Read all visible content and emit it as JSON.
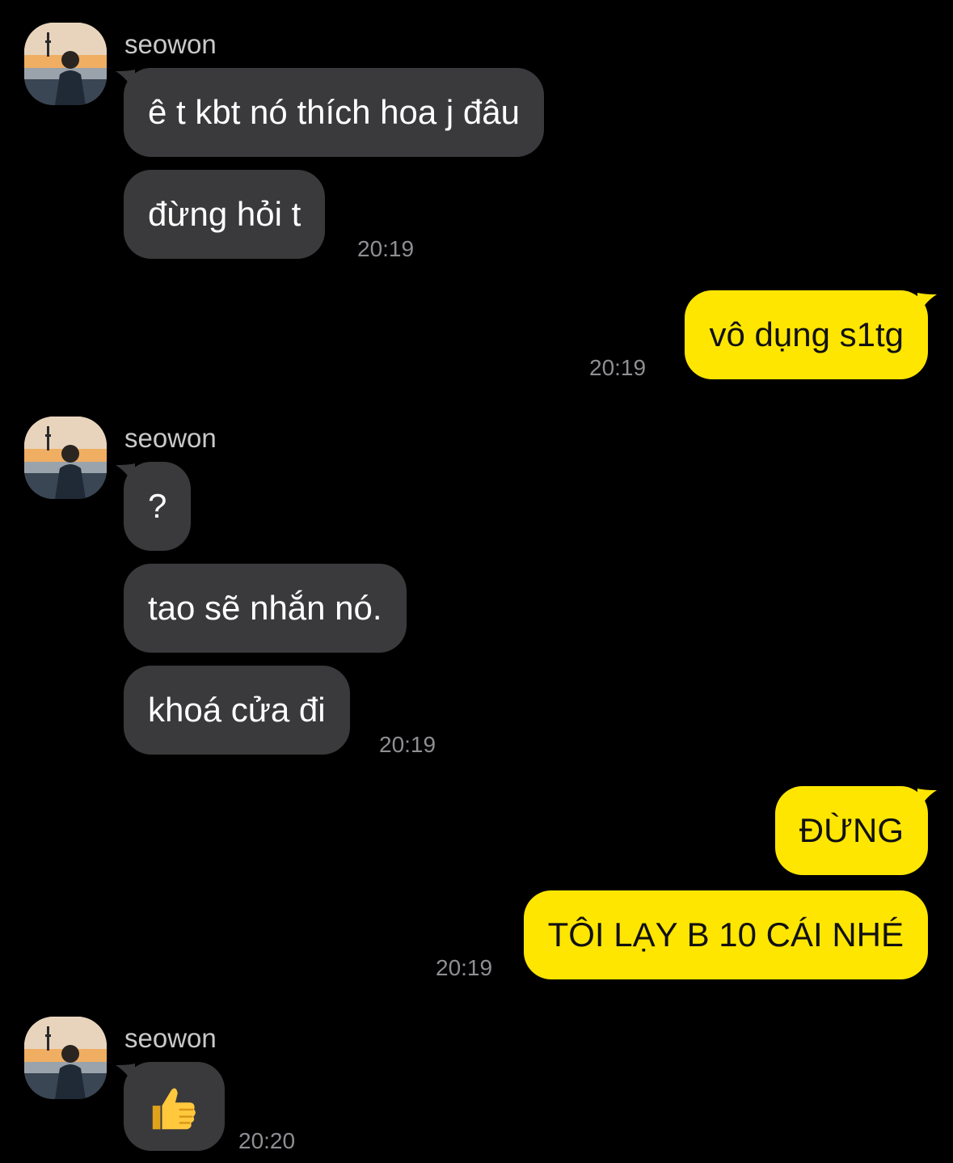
{
  "contact": {
    "name": "seowon"
  },
  "groups": [
    {
      "sender": "seowon",
      "messages": [
        "ê t kbt nó thích hoa j đâu",
        "đừng hỏi t"
      ],
      "time": "20:19"
    },
    {
      "sender": "me",
      "messages": [
        "vô dụng s1tg"
      ],
      "time": "20:19"
    },
    {
      "sender": "seowon",
      "messages": [
        "?",
        "tao sẽ nhắn nó.",
        "khoá cửa đi"
      ],
      "time": "20:19"
    },
    {
      "sender": "me",
      "messages": [
        "ĐỪNG",
        "TÔI LẠY B 10 CÁI NHÉ"
      ],
      "time": "20:19"
    },
    {
      "sender": "seowon",
      "messages": [
        {
          "emoji": "thumbs-up-icon"
        }
      ],
      "time": "20:20"
    }
  ],
  "colors": {
    "background": "#000000",
    "incoming_bubble": "#3a3a3c",
    "outgoing_bubble": "#ffe600",
    "timestamp": "#8e8e93",
    "sender_name": "#c9c9c9"
  }
}
